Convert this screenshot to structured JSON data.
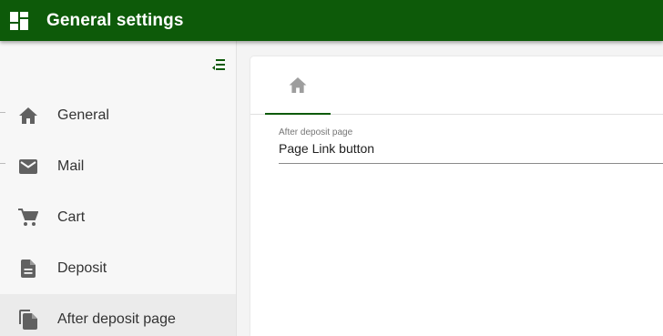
{
  "header": {
    "title": "General settings",
    "app_icon": "dashboard-icon",
    "background": "#0d5a09"
  },
  "sidebar": {
    "collapse_icon": "menu-collapse-icon",
    "items": [
      {
        "label": "General",
        "icon": "home-icon",
        "active": false
      },
      {
        "label": "Mail",
        "icon": "mail-icon",
        "active": false
      },
      {
        "label": "Cart",
        "icon": "cart-icon",
        "active": false
      },
      {
        "label": "Deposit",
        "icon": "document-icon",
        "active": false
      },
      {
        "label": "After deposit page",
        "icon": "copy-file-icon",
        "active": true
      }
    ]
  },
  "main": {
    "tabs": [
      {
        "icon": "home-icon",
        "active": true
      }
    ],
    "field": {
      "label": "After deposit page",
      "value": "Page Link button"
    }
  },
  "colors": {
    "accent": "#0d5a09",
    "icon_gray": "#616161"
  }
}
